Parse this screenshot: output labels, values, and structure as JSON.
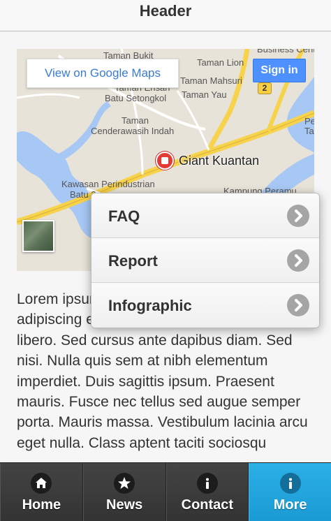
{
  "header": {
    "title": "Header"
  },
  "map": {
    "view_on_maps_label": "View on Google Maps",
    "sign_in_label": "Sign in",
    "route_number": "2",
    "poi_name": "Giant Kuantan",
    "labels": [
      "Taman Bukit",
      "Taman Lion",
      "Business Centre",
      "Taman Mahsuri",
      "Taman Yau",
      "Taman Ehsan",
      "Batu Setongkol",
      "Taman",
      "Cenderawasih Indah",
      "Pe",
      "Ta",
      "Kawasan Perindustrian",
      "Batu 3",
      "Kampung Peramu"
    ],
    "colors": {
      "water": "#a7c8f5",
      "land": "#e8e3d8",
      "highway": "#f7d24b",
      "road": "#ffffff"
    }
  },
  "body": {
    "text": "Lorem ipsum dolor sit amet, consectetur adipiscing elit. Integer nec odio. Praesent libero. Sed cursus ante dapibus diam. Sed nisi. Nulla quis sem at nibh elementum imperdiet. Duis sagittis ipsum. Praesent mauris. Fusce nec tellus sed augue semper porta. Mauris massa. Vestibulum lacinia arcu eget nulla. Class aptent taciti sociosqu"
  },
  "popup": {
    "items": [
      {
        "label": "FAQ",
        "icon": "chevron-right-icon"
      },
      {
        "label": "Report",
        "icon": "chevron-right-icon"
      },
      {
        "label": "Infographic",
        "icon": "chevron-right-icon"
      }
    ]
  },
  "footer": {
    "items": [
      {
        "label": "Home",
        "icon": "home-icon"
      },
      {
        "label": "News",
        "icon": "star-icon"
      },
      {
        "label": "Contact",
        "icon": "info-icon"
      },
      {
        "label": "More",
        "icon": "info-icon",
        "active": true
      }
    ],
    "colors": {
      "bar": "#3c3c3c",
      "active": "#1fa3dc"
    }
  }
}
